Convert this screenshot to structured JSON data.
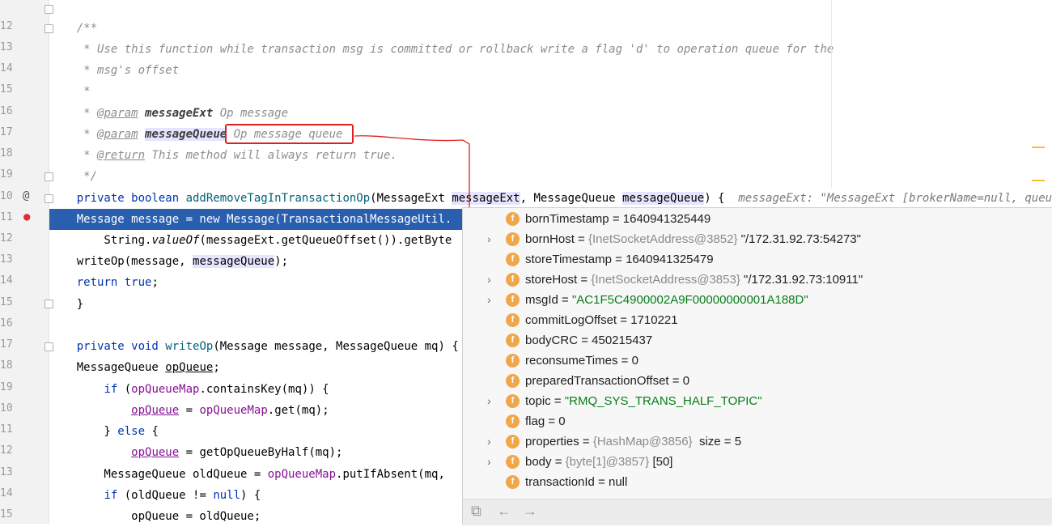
{
  "line_numbers": [
    "12",
    "13",
    "14",
    "15",
    "16",
    "17",
    "18",
    "19",
    "10",
    "11",
    "12",
    "13",
    "14",
    "15",
    "16",
    "17",
    "18",
    "19",
    "10",
    "11",
    "12",
    "13",
    "14",
    "15",
    "16"
  ],
  "code": {
    "javadoc_open": "/**",
    "doc_line1": " * Use this function while transaction msg is committed or rollback write a flag 'd' to operation queue for the",
    "doc_line2": " * msg's offset",
    "doc_line3": " *",
    "doc_star": " * ",
    "param_tag": "@param",
    "param1_name": "messageExt",
    "param1_desc": " Op message",
    "param2_name": "messageQueue",
    "param2_desc": "Op message queue",
    "return_tag": "@return",
    "return_desc": " This method will always return true.",
    "doc_close": " */",
    "sig_kw": "private boolean ",
    "sig_fn": "addRemoveTagInTransactionOp",
    "sig_paren": "(MessageExt ",
    "sig_p1": "messageExt",
    "sig_mid": ", MessageQueue ",
    "sig_p2": "messageQueue",
    "sig_end": ") {",
    "sig_hint": "messageExt: \"MessageExt [brokerName=null, queueId=0,",
    "sel_line": "    Message message = new Message(TransactionalMessageUtil.",
    "line_valueof_a": "        String.",
    "line_valueof_b": "valueOf",
    "line_valueof_c": "(messageExt.getQueueOffset()).getByte",
    "writeop_call_a": "    writeOp(message, ",
    "writeop_call_b": "messageQueue",
    "writeop_call_c": ");",
    "return_kw": "return",
    "true_kw": "true",
    "close_brace": "}",
    "writeop_sig_kw": "private void ",
    "writeop_sig_fn": "writeOp",
    "writeop_sig_rest": "(Message message, MessageQueue mq) {",
    "mq_decl_a": "    MessageQueue ",
    "mq_decl_b": "opQueue",
    "mq_decl_c": ";",
    "if_kw": "if",
    "if_a": " (",
    "opqueuemap": "opQueueMap",
    "if_b": ".containsKey(mq)) {",
    "opqueue": "opQueue",
    "assign_get": ".get(mq);",
    "else_kw": "else",
    "assign_half": " = getOpQueueByHalf(mq);",
    "old_a": "        MessageQueue oldQueue = ",
    "old_b": ".putIfAbsent(mq,",
    "if2_b": " (oldQueue != ",
    "null_kw": "null",
    "if2_c": ") {",
    "last_line": "            opQueue = oldQueue;"
  },
  "debugger": {
    "rows": [
      {
        "name": "bornTimestamp",
        "sep": " = ",
        "ref": "",
        "value": "1640941325449",
        "is_string": false,
        "expandable": false
      },
      {
        "name": "bornHost",
        "sep": " = ",
        "ref": "{InetSocketAddress@3852} ",
        "value": "\"/172.31.92.73:54273\"",
        "is_string": false,
        "expandable": true
      },
      {
        "name": "storeTimestamp",
        "sep": " = ",
        "ref": "",
        "value": "1640941325479",
        "is_string": false,
        "expandable": false
      },
      {
        "name": "storeHost",
        "sep": " = ",
        "ref": "{InetSocketAddress@3853} ",
        "value": "\"/172.31.92.73:10911\"",
        "is_string": false,
        "expandable": true
      },
      {
        "name": "msgId",
        "sep": " = ",
        "ref": "",
        "value": "\"AC1F5C4900002A9F00000000001A188D\"",
        "is_string": true,
        "expandable": true
      },
      {
        "name": "commitLogOffset",
        "sep": " = ",
        "ref": "",
        "value": "1710221",
        "is_string": false,
        "expandable": false
      },
      {
        "name": "bodyCRC",
        "sep": " = ",
        "ref": "",
        "value": "450215437",
        "is_string": false,
        "expandable": false
      },
      {
        "name": "reconsumeTimes",
        "sep": " = ",
        "ref": "",
        "value": "0",
        "is_string": false,
        "expandable": false
      },
      {
        "name": "preparedTransactionOffset",
        "sep": " = ",
        "ref": "",
        "value": "0",
        "is_string": false,
        "expandable": false
      },
      {
        "name": "topic",
        "sep": " = ",
        "ref": "",
        "value": "\"RMQ_SYS_TRANS_HALF_TOPIC\"",
        "is_string": true,
        "expandable": true
      },
      {
        "name": "flag",
        "sep": " = ",
        "ref": "",
        "value": "0",
        "is_string": false,
        "expandable": false
      },
      {
        "name": "properties",
        "sep": " = ",
        "ref": "{HashMap@3856} ",
        "value": " size = 5",
        "is_string": false,
        "expandable": true
      },
      {
        "name": "body",
        "sep": " = ",
        "ref": "{byte[1]@3857} ",
        "value": "[50]",
        "is_string": false,
        "expandable": true
      },
      {
        "name": "transactionId",
        "sep": " = ",
        "ref": "",
        "value": "null",
        "is_string": false,
        "expandable": false
      }
    ],
    "field_icon_letter": "f",
    "expand_arrow": "›",
    "toolbar_icons": [
      "show-types-icon",
      "back-arrow-icon",
      "forward-arrow-icon"
    ],
    "toolbar_glyphs": [
      "⧉",
      "←",
      "→"
    ]
  },
  "gutter": {
    "override_marker": "@",
    "breakpoint_marker": "●"
  },
  "colors": {
    "selection": "#2a5fb0",
    "annotation_red": "#e02020",
    "field_icon": "#f0a74a",
    "string_green": "#067d17",
    "keyword_blue": "#0033b3"
  }
}
